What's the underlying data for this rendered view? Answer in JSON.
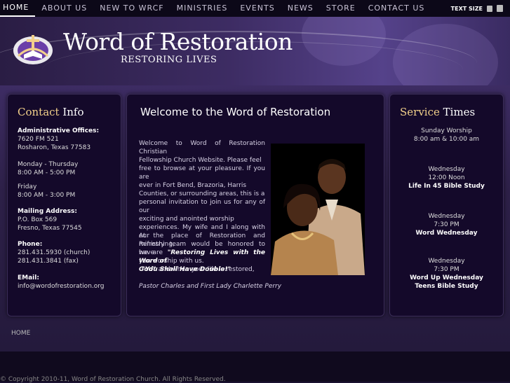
{
  "nav": {
    "items": [
      "HOME",
      "ABOUT US",
      "NEW TO WRCF",
      "MINISTRIES",
      "EVENTS",
      "NEWS",
      "STORE",
      "CONTACT US"
    ],
    "text_size_label": "TEXT SIZE"
  },
  "header": {
    "brand": "Word of Restoration",
    "tagline": "RESTORING LIVES"
  },
  "contact": {
    "title_hl": "Contact",
    "title_rest": " Info",
    "admin_label": "Administrative Offices:",
    "admin_line1": "7620 FM 521",
    "admin_line2": "Rosharon, Texas 77583",
    "hours1_days": "Monday - Thursday",
    "hours1_time": "8:00 AM - 5:00 PM",
    "hours2_days": "Friday",
    "hours2_time": "8:00 AM - 3:00 PM",
    "mail_label": "Mailing Address:",
    "mail_line1": "P.O. Box 569",
    "mail_line2": "Fresno, Texas 77545",
    "phone_label": "Phone:",
    "phone1": "281.431.5930 (church)",
    "phone2": "281.431.3841 (fax)",
    "email_label": "EMail:",
    "email": "info@wordofrestoration.org"
  },
  "welcome": {
    "title": "Welcome to the Word of Restoration",
    "para1_l1": "Welcome to Word of Restoration Christian",
    "para1_l2": "Fellowship Church Website. Please feel",
    "para1_l3": "free to browse at your pleasure. If you are",
    "para1_l4": "ever in Fort Bend, Brazoria, Harris",
    "para1_l5": "Counties, or surrounding areas, this is a",
    "para1_l6": "personal invitation to join us for any of our",
    "para1_l7": "exciting and anointed worship",
    "para1_l8": "experiences. My wife and I along with our",
    "para1_l9": "ministry team would be honored to have",
    "para1_l10": "you worship with us.",
    "para2_l1": "At the place of Restoration and Refreshing,",
    "para2_l2a": "we are ",
    "para2_l2b": "\"Restoring Lives with the Word of",
    "para2_l3a": "God\"",
    "para2_l3b": " and when your life is restored,",
    "quote": "\"You Shall Have Double!\"",
    "signature": "Pastor Charles and First Lady Charlette Perry"
  },
  "service": {
    "title_hl": "Service",
    "title_rest": " Times",
    "s1_day": "Sunday Worship",
    "s1_time": "8:00 am & 10:00 am",
    "s2_day": "Wednesday",
    "s2_time": "12:00 Noon",
    "s2_name": "Life In 45 Bible Study",
    "s3_day": "Wednesday",
    "s3_time": "7:30 PM",
    "s3_name": "Word Wednesday",
    "s4_day": "Wednesday",
    "s4_time": "7:30 PM",
    "s4_name1": "Word Up Wednesday",
    "s4_name2": "Teens Bible Study"
  },
  "breadcrumb": "HOME",
  "footer": {
    "copyright": "© Copyright 2010-11, Word of Restoration Church. All Rights Reserved."
  },
  "colors": {
    "accent": "#f2d08a",
    "panel_bg": "#14092a",
    "nav_bg": "#0c0818"
  }
}
